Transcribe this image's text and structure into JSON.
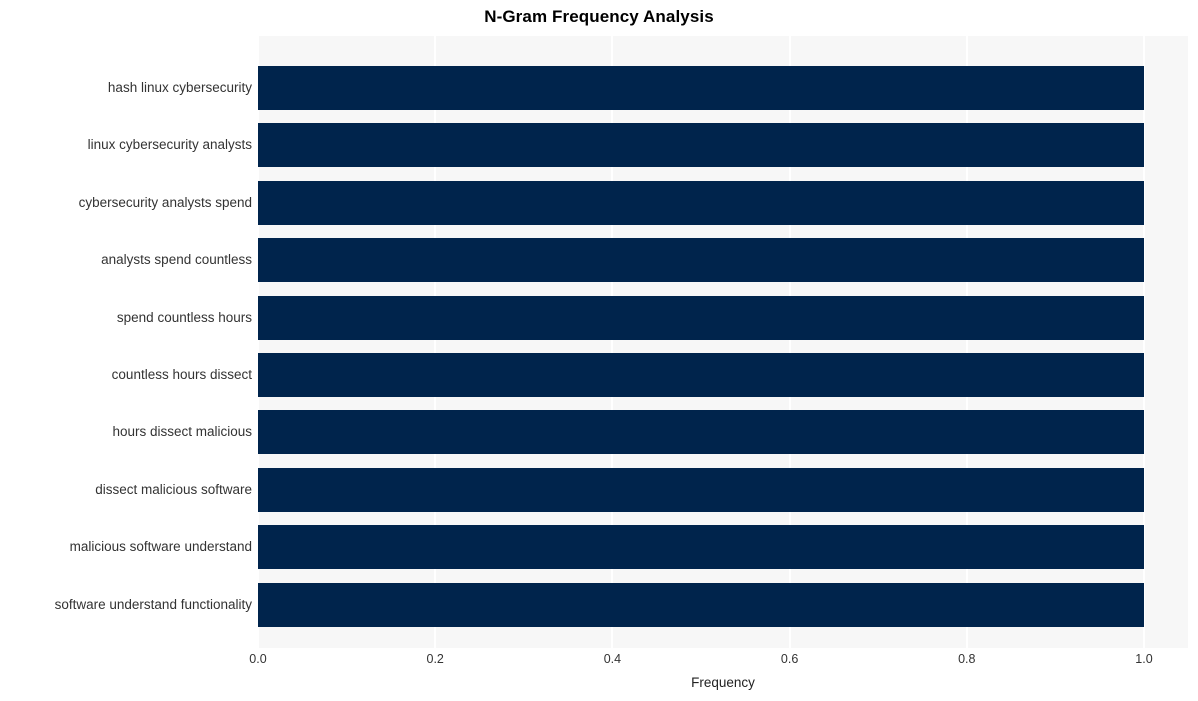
{
  "chart_data": {
    "type": "bar",
    "orientation": "horizontal",
    "title": "N-Gram Frequency Analysis",
    "xlabel": "Frequency",
    "ylabel": "",
    "xlim": [
      0.0,
      1.0
    ],
    "xticks": [
      "0.0",
      "0.2",
      "0.4",
      "0.6",
      "0.8",
      "1.0"
    ],
    "xtick_values": [
      0.0,
      0.2,
      0.4,
      0.6,
      0.8,
      1.0
    ],
    "grid": true,
    "legend": null,
    "categories": [
      "hash linux cybersecurity",
      "linux cybersecurity analysts",
      "cybersecurity analysts spend",
      "analysts spend countless",
      "spend countless hours",
      "countless hours dissect",
      "hours dissect malicious",
      "dissect malicious software",
      "malicious software understand",
      "software understand functionality"
    ],
    "values": [
      1.0,
      1.0,
      1.0,
      1.0,
      1.0,
      1.0,
      1.0,
      1.0,
      1.0,
      1.0
    ],
    "colors": {
      "bar": "#00244c",
      "plot_background": "#f7f7f7",
      "figure_background": "#ffffff",
      "gridline": "#ffffff",
      "title_text": "#000000",
      "tick_text": "#333333"
    }
  }
}
